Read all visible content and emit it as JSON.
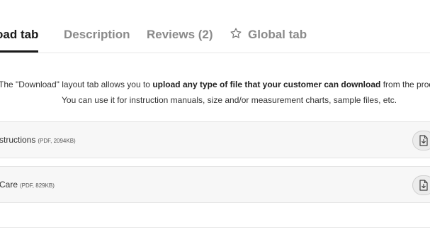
{
  "tabs": {
    "download": "oad tab",
    "description": "Description",
    "reviews": "Reviews (2)",
    "global": "Global tab",
    "global_icon": "star-outline-icon"
  },
  "intro": {
    "line1_pre": "The \"Download\" layout tab allows you to ",
    "line1_bold": "upload any type of file that your customer can download",
    "line1_post": " from the product page.",
    "line2": "You can use it for instruction manuals, size and/or measurement charts, sample files, etc."
  },
  "files": [
    {
      "name": "structions",
      "meta": "(PDF, 2094KB)",
      "icon": "file-download-icon"
    },
    {
      "name": "Care",
      "meta": "(PDF, 829KB)",
      "icon": "file-download-icon"
    }
  ],
  "colors": {
    "active_tab": "#1a1a1a",
    "inactive_tab": "#8a8a8a",
    "row_background": "#f7f7f7"
  }
}
